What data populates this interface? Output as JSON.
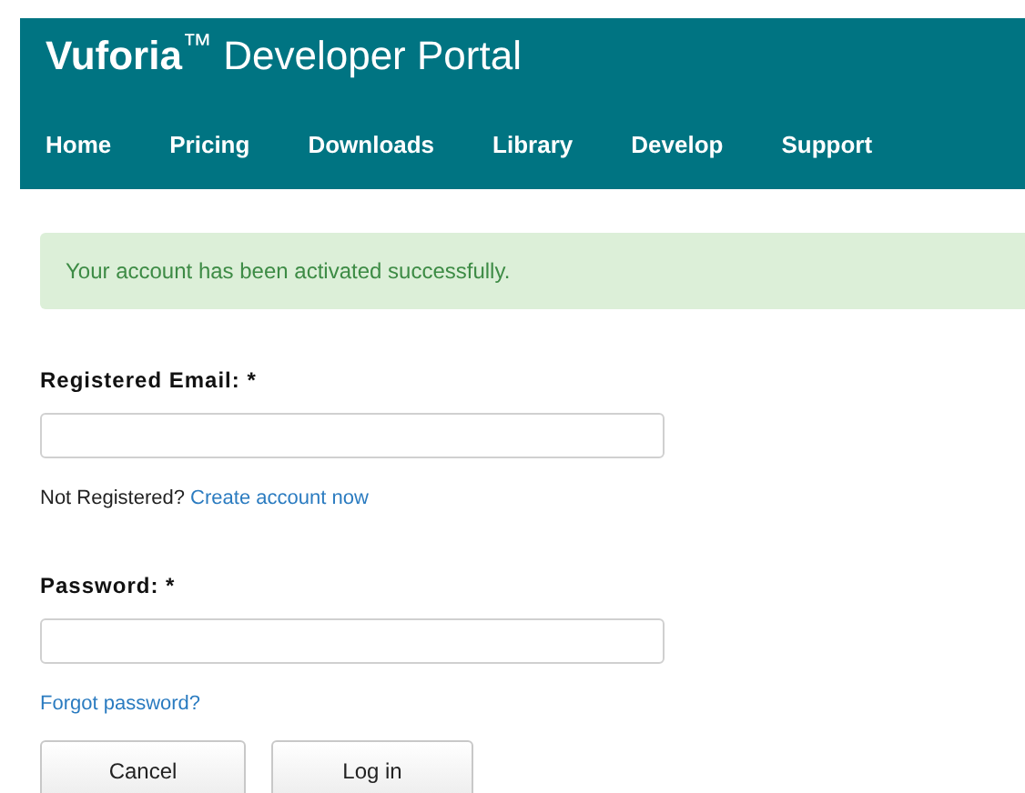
{
  "header": {
    "title": "**Vuforia**$^{™}$ Developer Portal",
    "nav": [
      {
        "label": "Home"
      },
      {
        "label": "Pricing"
      },
      {
        "label": "Downloads"
      },
      {
        "label": "Library"
      },
      {
        "label": "Develop"
      },
      {
        "label": "Support"
      }
    ]
  },
  "alert": {
    "text": "Your account has been activated successfully."
  },
  "form": {
    "fields": [
      {
        "label": "Registered Email: *",
        "help": {
          "text": "Not Registered?",
          "link": "Create account now"
        }
      },
      {
        "label": "Password: *",
        "help": {
          "link": "Forgot password?"
        }
      }
    ],
    "buttons": [
      "Cancel",
      "Log in"
    ]
  }
}
